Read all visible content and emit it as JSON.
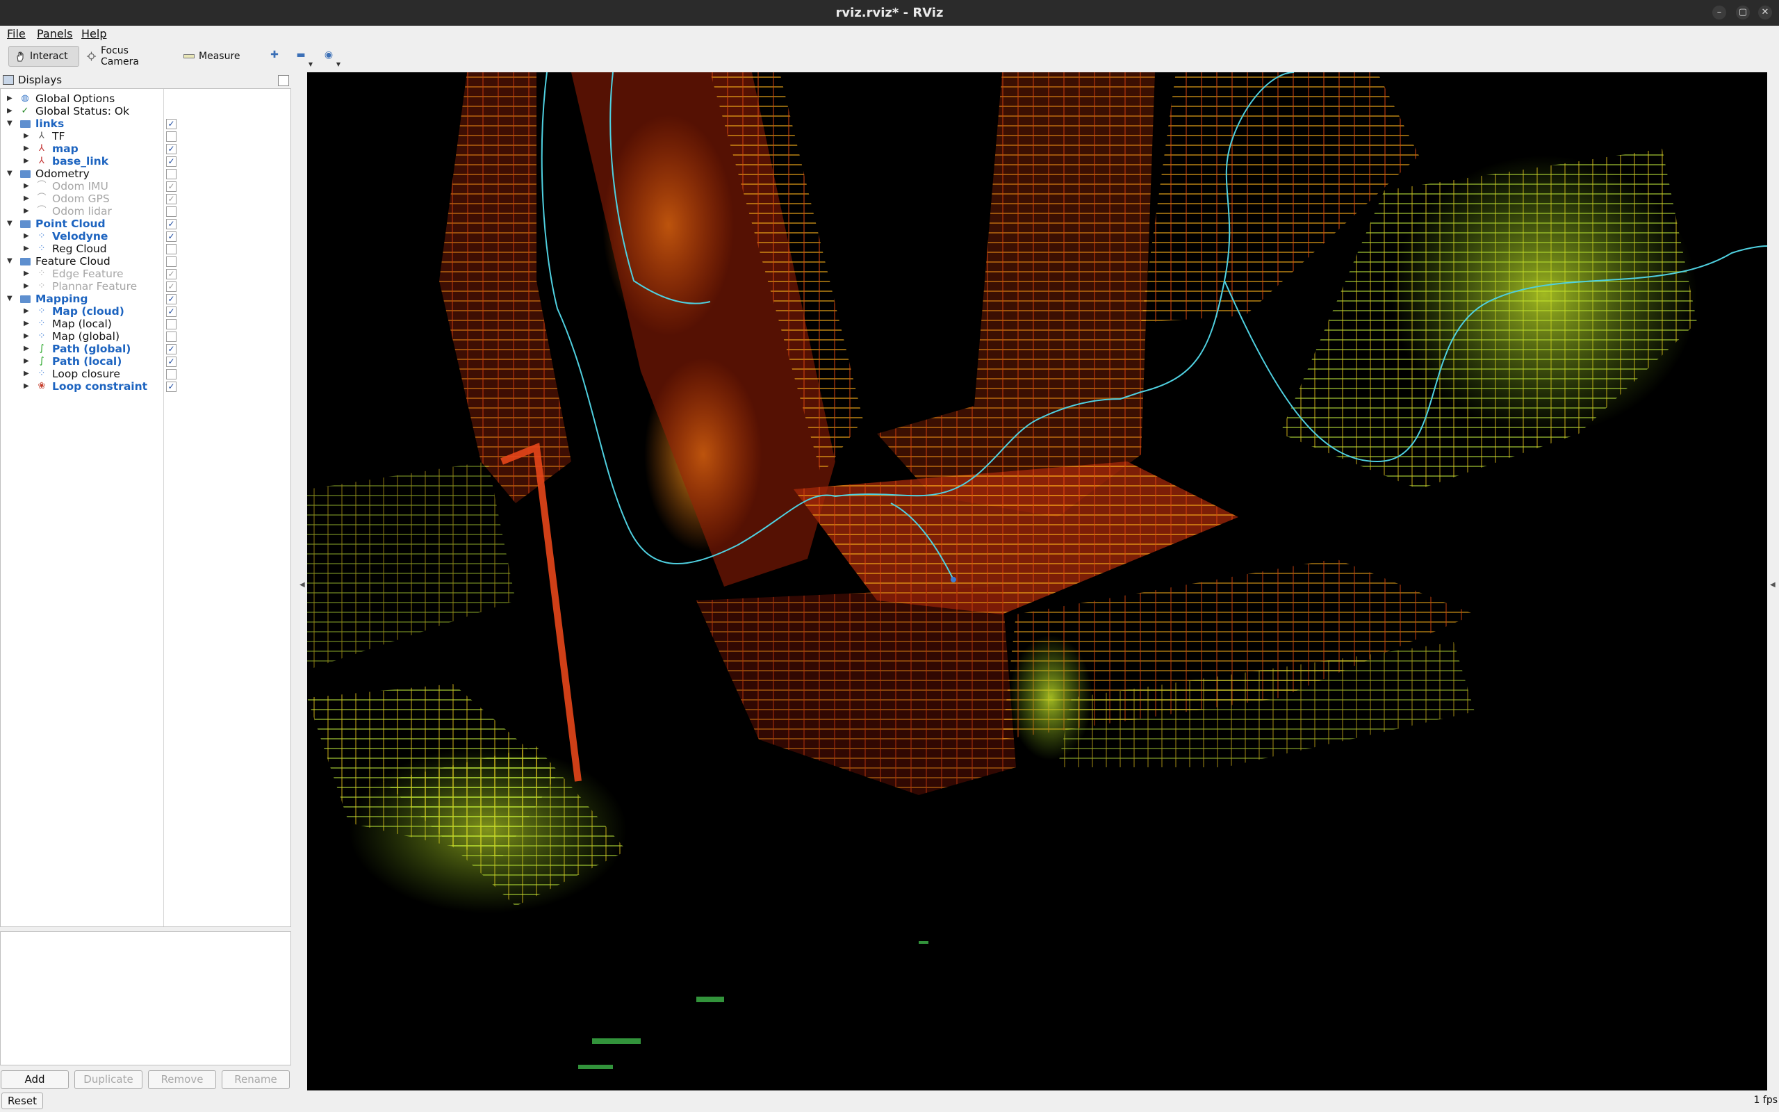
{
  "window": {
    "title": "rviz.rviz* - RViz",
    "minimize_glyph": "–",
    "restore_glyph": "▢",
    "close_glyph": "✕"
  },
  "menu": [
    "File",
    "Panels",
    "Help"
  ],
  "toolbar": {
    "tools": [
      {
        "label": "Interact",
        "icon": "hand-icon"
      },
      {
        "label": "Focus Camera",
        "icon": "crosshair-icon"
      },
      {
        "label": "Measure",
        "icon": "ruler-icon"
      }
    ],
    "extra_icons": [
      "add-tool-icon",
      "remove-tool-icon",
      "eye-icon"
    ]
  },
  "displays_panel": {
    "title": "Displays",
    "tree": [
      {
        "label": "Global Options",
        "level": 0,
        "icon": "globe-icon",
        "style": "normal",
        "checkbox": "none",
        "expander": "collapsed"
      },
      {
        "label": "Global Status: Ok",
        "level": 0,
        "icon": "ok-check-icon",
        "style": "normal",
        "checkbox": "none",
        "expander": "collapsed"
      },
      {
        "label": "links",
        "level": 0,
        "icon": "folder-icon",
        "style": "bold",
        "checkbox": "checked",
        "expander": "expanded"
      },
      {
        "label": "TF",
        "level": 1,
        "icon": "tf-axes-icon",
        "style": "normal",
        "checkbox": "unchecked",
        "expander": "collapsed"
      },
      {
        "label": "map",
        "level": 1,
        "icon": "axes-icon",
        "style": "bold",
        "checkbox": "checked",
        "expander": "collapsed"
      },
      {
        "label": "base_link",
        "level": 1,
        "icon": "axes-icon",
        "style": "bold",
        "checkbox": "checked",
        "expander": "collapsed"
      },
      {
        "label": "Odometry",
        "level": 0,
        "icon": "folder-icon",
        "style": "normal",
        "checkbox": "unchecked",
        "expander": "expanded"
      },
      {
        "label": "Odom IMU",
        "level": 1,
        "icon": "odometry-icon",
        "style": "disabled",
        "checkbox": "grey-checked",
        "expander": "collapsed"
      },
      {
        "label": "Odom GPS",
        "level": 1,
        "icon": "odometry-icon",
        "style": "disabled",
        "checkbox": "grey-checked",
        "expander": "collapsed"
      },
      {
        "label": "Odom lidar",
        "level": 1,
        "icon": "odometry-icon",
        "style": "disabled",
        "checkbox": "grey-unchecked",
        "expander": "collapsed"
      },
      {
        "label": "Point Cloud",
        "level": 0,
        "icon": "folder-icon",
        "style": "bold",
        "checkbox": "checked",
        "expander": "expanded"
      },
      {
        "label": "Velodyne",
        "level": 1,
        "icon": "pointcloud-icon",
        "style": "bold",
        "checkbox": "checked",
        "expander": "collapsed"
      },
      {
        "label": "Reg Cloud",
        "level": 1,
        "icon": "pointcloud-icon",
        "style": "normal",
        "checkbox": "unchecked",
        "expander": "collapsed"
      },
      {
        "label": "Feature Cloud",
        "level": 0,
        "icon": "folder-icon",
        "style": "normal",
        "checkbox": "unchecked",
        "expander": "expanded"
      },
      {
        "label": "Edge Feature",
        "level": 1,
        "icon": "pointcloud-icon",
        "style": "disabled",
        "checkbox": "grey-checked",
        "expander": "collapsed"
      },
      {
        "label": "Plannar Feature",
        "level": 1,
        "icon": "pointcloud-icon",
        "style": "disabled",
        "checkbox": "grey-checked",
        "expander": "collapsed"
      },
      {
        "label": "Mapping",
        "level": 0,
        "icon": "folder-icon",
        "style": "bold",
        "checkbox": "checked",
        "expander": "expanded"
      },
      {
        "label": "Map (cloud)",
        "level": 1,
        "icon": "pointcloud-icon",
        "style": "bold",
        "checkbox": "checked",
        "expander": "collapsed"
      },
      {
        "label": "Map (local)",
        "level": 1,
        "icon": "pointcloud-icon",
        "style": "normal",
        "checkbox": "unchecked",
        "expander": "collapsed"
      },
      {
        "label": "Map (global)",
        "level": 1,
        "icon": "pointcloud-icon",
        "style": "normal",
        "checkbox": "unchecked",
        "expander": "collapsed"
      },
      {
        "label": "Path (global)",
        "level": 1,
        "icon": "path-icon",
        "style": "bold",
        "checkbox": "checked",
        "expander": "collapsed"
      },
      {
        "label": "Path (local)",
        "level": 1,
        "icon": "path-icon",
        "style": "bold",
        "checkbox": "checked",
        "expander": "collapsed"
      },
      {
        "label": "Loop closure",
        "level": 1,
        "icon": "pointcloud-icon",
        "style": "normal",
        "checkbox": "unchecked",
        "expander": "collapsed"
      },
      {
        "label": "Loop constraint",
        "level": 1,
        "icon": "marker-array-icon",
        "style": "bold",
        "checkbox": "checked",
        "expander": "collapsed"
      }
    ],
    "buttons": {
      "add": "Add",
      "duplicate": "Duplicate",
      "remove": "Remove",
      "rename": "Rename"
    }
  },
  "bottom": {
    "reset": "Reset",
    "fps": "1 fps"
  },
  "colors": {
    "accent_blue": "#1d64c0",
    "viewport_bg": "#000000",
    "trajectory": "#4fd0e0"
  },
  "viewport": {
    "content": "3D point cloud map view, intensity colored red-orange-yellow-green, with cyan trajectory path"
  }
}
